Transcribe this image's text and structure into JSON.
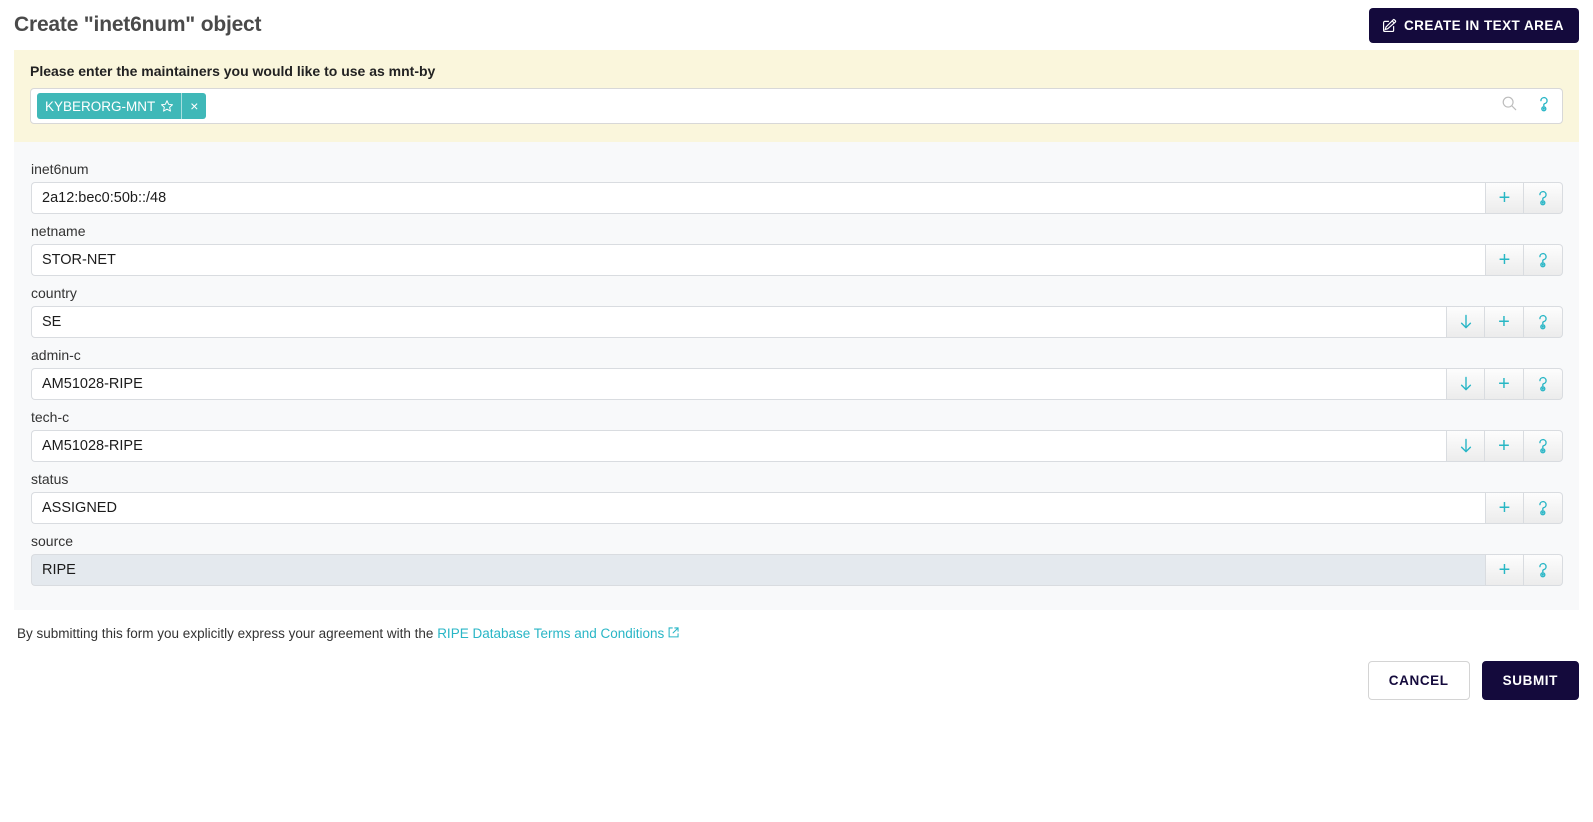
{
  "header": {
    "title": "Create \"inet6num\" object",
    "create_text_area_label": "CREATE IN TEXT AREA"
  },
  "maintainers": {
    "prompt": "Please enter the maintainers you would like to use as mnt-by",
    "chips": [
      {
        "label": "KYBERORG-MNT",
        "close_label": "×"
      }
    ],
    "search_placeholder": ""
  },
  "fields": [
    {
      "label": "inet6num",
      "value": "2a12:bec0:50b::/48",
      "readonly": false,
      "has_dropdown": false,
      "plus_label": "+"
    },
    {
      "label": "netname",
      "value": "STOR-NET",
      "readonly": false,
      "has_dropdown": false,
      "plus_label": "+"
    },
    {
      "label": "country",
      "value": "SE",
      "readonly": false,
      "has_dropdown": true,
      "plus_label": "+"
    },
    {
      "label": "admin-c",
      "value": "AM51028-RIPE",
      "readonly": false,
      "has_dropdown": true,
      "plus_label": "+"
    },
    {
      "label": "tech-c",
      "value": "AM51028-RIPE",
      "readonly": false,
      "has_dropdown": true,
      "plus_label": "+"
    },
    {
      "label": "status",
      "value": "ASSIGNED",
      "readonly": false,
      "has_dropdown": false,
      "plus_label": "+"
    },
    {
      "label": "source",
      "value": "RIPE",
      "readonly": true,
      "has_dropdown": false,
      "plus_label": "+"
    }
  ],
  "footer": {
    "terms_prefix": "By submitting this form you explicitly express your agreement with the ",
    "terms_link": "RIPE Database Terms and Conditions",
    "cancel_label": "CANCEL",
    "submit_label": "SUBMIT"
  },
  "colors": {
    "accent_teal": "#29b6c6",
    "chip_teal": "#3fb8b8",
    "navy": "#140a3c",
    "cream_band": "#faf6dc",
    "panel_gray": "#f8f9fa",
    "readonly_gray": "#e4e9ee"
  },
  "icons": {
    "edit": "edit-icon",
    "search": "search-icon",
    "help": "help-icon",
    "star": "star-icon",
    "plus": "plus-icon",
    "arrow_down": "arrow-down-icon",
    "external_link": "external-link-icon"
  }
}
